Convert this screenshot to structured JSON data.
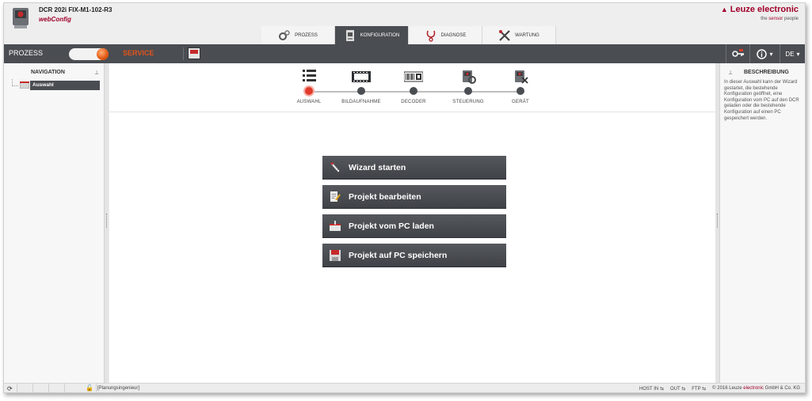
{
  "header": {
    "device_title": "DCR 202i FIX-M1-102-R3",
    "device_subtitle": "webConfig",
    "brand_name": "Leuze electronic",
    "tagline_pre": "the ",
    "tagline_red": "sensor",
    "tagline_post": " people"
  },
  "tabs": [
    {
      "label": "PROZESS",
      "icon": "gears-icon",
      "active": false
    },
    {
      "label": "KONFIGURATION",
      "icon": "config-icon",
      "active": true
    },
    {
      "label": "DIAGNOSE",
      "icon": "stethoscope-icon",
      "active": false
    },
    {
      "label": "WARTUNG",
      "icon": "tools-icon",
      "active": false
    }
  ],
  "toolbar": {
    "mode_prozess": "PROZESS",
    "mode_service": "SERVICE",
    "language": "DE"
  },
  "navigation": {
    "title": "NAVIGATION",
    "items": [
      {
        "label": "Auswahl"
      }
    ]
  },
  "steps": [
    {
      "label": "AUSWAHL",
      "icon": "list-icon",
      "active": true
    },
    {
      "label": "BILDAUFNAHME",
      "icon": "film-icon",
      "active": false
    },
    {
      "label": "DECODER",
      "icon": "barcode-icon",
      "active": false
    },
    {
      "label": "STEUERUNG",
      "icon": "control-icon",
      "active": false
    },
    {
      "label": "GERÄT",
      "icon": "device-icon",
      "active": false
    }
  ],
  "actions": [
    {
      "label": "Wizard starten",
      "icon": "wand-icon"
    },
    {
      "label": "Projekt bearbeiten",
      "icon": "edit-icon"
    },
    {
      "label": "Projekt vom PC laden",
      "icon": "load-icon"
    },
    {
      "label": "Projekt auf PC speichern",
      "icon": "save-icon"
    }
  ],
  "description": {
    "title": "BESCHREIBUNG",
    "text": "In dieser Auswahl kann der Wizard gestartet, die bestehende Konfiguration geöffnet, eine Konfiguration vom PC auf den DCR geladen oder die bestehende Konfiguration auf einen PC gespeichert werden."
  },
  "status": {
    "role": "[Planungsingenieur]",
    "host_in": "HOST IN",
    "out": "OUT",
    "ftp": "FTP",
    "copyright_pre": "© 2016 Leuze ",
    "copyright_red": "electronic",
    "copyright_post": " GmbH & Co. KG"
  },
  "colors": {
    "brand_red": "#a0002a",
    "toolbar_dark": "#4a4d52",
    "service_orange": "#e0531c",
    "step_active": "#e23b2a"
  }
}
